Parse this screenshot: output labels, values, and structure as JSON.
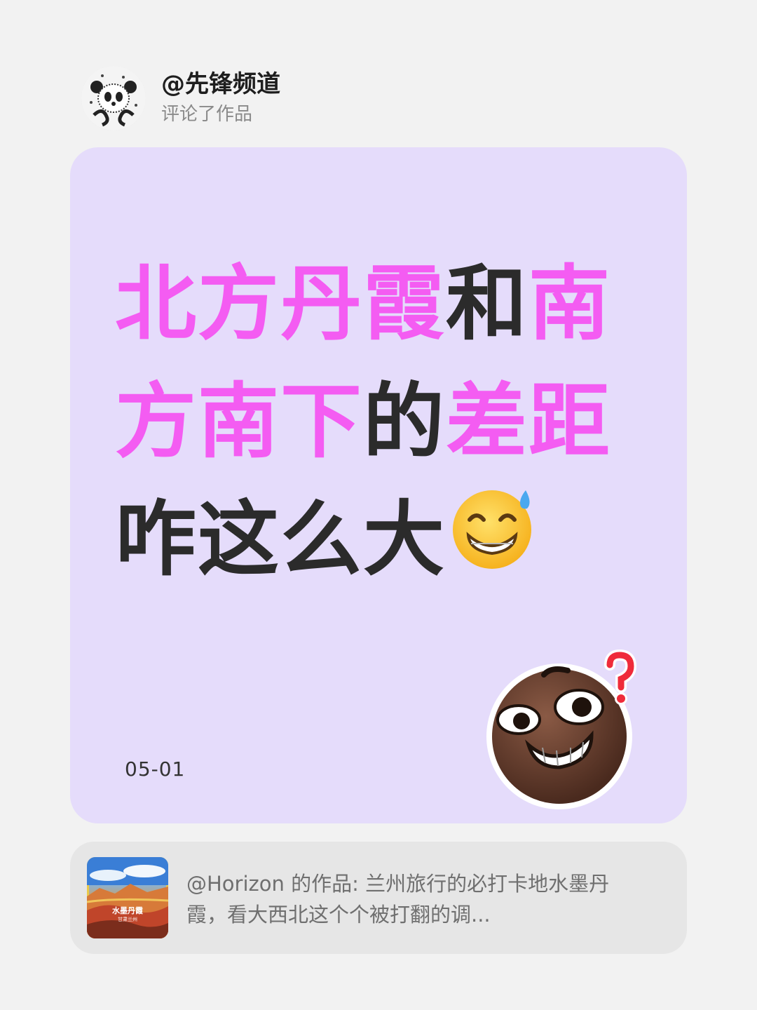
{
  "header": {
    "username": "@先锋频道",
    "action": "评论了作品",
    "avatar_icon": "panda-avatar"
  },
  "card": {
    "background": "#e5dcfb",
    "headline": {
      "line1_pink": "北方丹霞",
      "line1_dark": "和",
      "line1_pink2": "南",
      "line2_pink": "方南下",
      "line2_dark": "的",
      "line2_pink2": "差距",
      "line3_dark": "咋这么大"
    },
    "highlight_color": "#f45cf2",
    "text_color": "#2b2b2b",
    "inline_emoji": "grinning-sweat-emoji",
    "date": "05-01",
    "corner_emoji": "confused-grin-face-emoji"
  },
  "referenced_work": {
    "thumbnail_icon": "danxia-landscape-thumbnail",
    "thumbnail_title": "水墨丹霞",
    "thumbnail_subtitle": "甘肃兰州",
    "line1": "@Horizon 的作品: 兰州旅行的必打卡地水墨丹",
    "line2": "霞，看大西北这个个被打翻的调..."
  }
}
